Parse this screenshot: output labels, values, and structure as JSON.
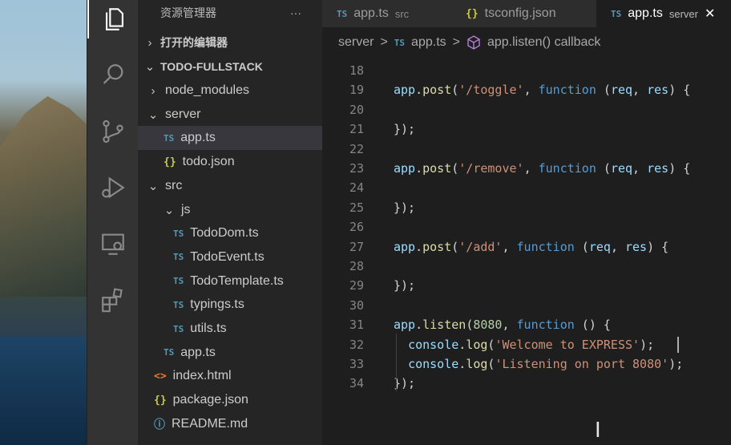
{
  "sidebar": {
    "title": "资源管理器",
    "more_label": "···",
    "open_editors": "打开的编辑器",
    "project": "TODO-FULLSTACK",
    "tree": [
      {
        "label": "node_modules",
        "icon": "chevron-right"
      },
      {
        "label": "server",
        "icon": "chevron-down"
      },
      {
        "label": "app.ts",
        "icon": "ts",
        "icon_text": "TS"
      },
      {
        "label": "todo.json",
        "icon": "json",
        "icon_text": "{}"
      },
      {
        "label": "src",
        "icon": "chevron-down"
      },
      {
        "label": "js",
        "icon": "chevron-down"
      },
      {
        "label": "TodoDom.ts",
        "icon": "ts",
        "icon_text": "TS"
      },
      {
        "label": "TodoEvent.ts",
        "icon": "ts",
        "icon_text": "TS"
      },
      {
        "label": "TodoTemplate.ts",
        "icon": "ts",
        "icon_text": "TS"
      },
      {
        "label": "typings.ts",
        "icon": "ts",
        "icon_text": "TS"
      },
      {
        "label": "utils.ts",
        "icon": "ts",
        "icon_text": "TS"
      },
      {
        "label": "app.ts",
        "icon": "ts",
        "icon_text": "TS"
      },
      {
        "label": "index.html",
        "icon": "html",
        "icon_text": "<>"
      },
      {
        "label": "package.json",
        "icon": "json",
        "icon_text": "{}"
      },
      {
        "label": "README.md",
        "icon": "info",
        "icon_text": "ⓘ"
      }
    ]
  },
  "tabs": [
    {
      "icon_text": "TS",
      "label": "app.ts",
      "desc": "src"
    },
    {
      "icon_text": "{}",
      "label": "tsconfig.json",
      "desc": ""
    },
    {
      "icon_text": "TS",
      "label": "app.ts",
      "desc": "server",
      "close": "✕"
    }
  ],
  "breadcrumb": {
    "folder": "server",
    "file_icon": "TS",
    "file": "app.ts",
    "symbol": "app.listen() callback",
    "sep": ">"
  },
  "code": {
    "line_numbers": [
      "18",
      "19",
      "20",
      "21",
      "22",
      "23",
      "24",
      "25",
      "26",
      "27",
      "28",
      "29",
      "30",
      "31",
      "32",
      "33",
      "34"
    ],
    "lines": [
      "",
      "app.post('/toggle', function (req, res) {",
      "",
      "});",
      "",
      "app.post('/remove', function (req, res) {",
      "",
      "});",
      "",
      "app.post('/add', function (req, res) {",
      "",
      "});",
      "",
      "app.listen(8080, function () {",
      "  console.log('Welcome to EXPRESS');",
      "  console.log('Listening on port 8080');",
      "});"
    ]
  },
  "colors": {
    "activity_bg": "#333333",
    "sidebar_bg": "#252526",
    "editor_bg": "#1e1e1e",
    "ts_icon": "#519aba",
    "json_icon": "#cbcb41"
  }
}
